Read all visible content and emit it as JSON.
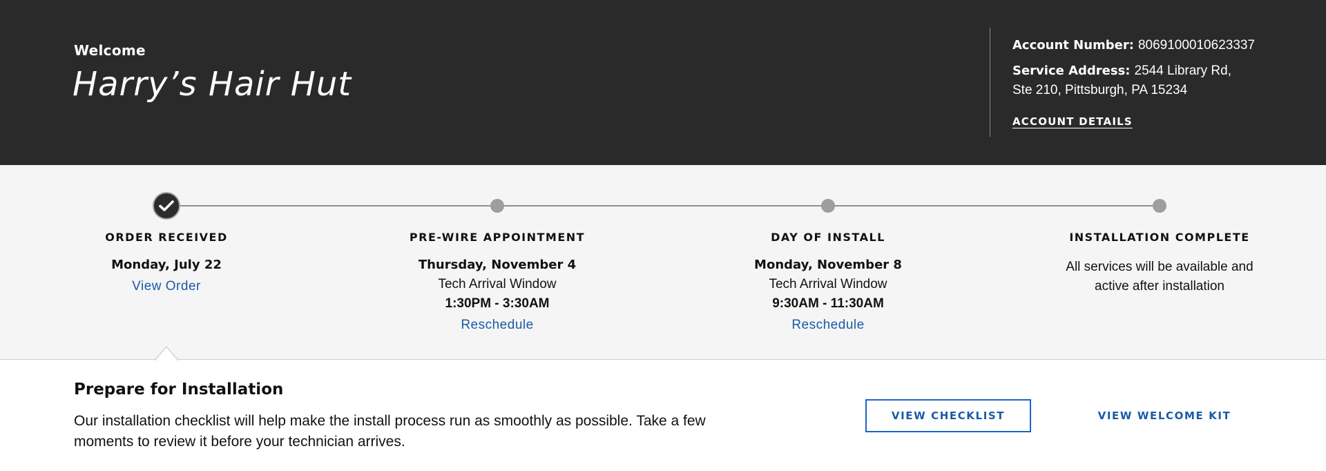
{
  "header": {
    "welcome_label": "Welcome",
    "business_name": "Harry’s Hair Hut",
    "account_number_label": "Account Number:",
    "account_number": "8069100010623337",
    "service_address_label": "Service Address:",
    "service_address_line1": "2544 Library Rd,",
    "service_address_line2": "Ste 210, Pittsburgh, PA 15234",
    "account_details_link": "ACCOUNT DETAILS"
  },
  "timeline": {
    "steps": [
      {
        "title": "ORDER RECEIVED",
        "date": "Monday, July 22",
        "link": "View Order",
        "status": "complete"
      },
      {
        "title": "PRE-WIRE APPOINTMENT",
        "date": "Thursday, November 4",
        "window_label": "Tech Arrival Window",
        "window_time": "1:30PM - 3:30AM",
        "link": "Reschedule",
        "status": "pending"
      },
      {
        "title": "DAY OF INSTALL",
        "date": "Monday, November 8",
        "window_label": "Tech Arrival Window",
        "window_time": "9:30AM - 11:30AM",
        "link": "Reschedule",
        "status": "pending"
      },
      {
        "title": "INSTALLATION COMPLETE",
        "note_line1": "All services will be available and",
        "note_line2": "active after installation",
        "status": "pending"
      }
    ]
  },
  "prepare": {
    "title": "Prepare for Installation",
    "body_line1": "Our installation checklist will help make the install process run as smoothly as possible. Take a few",
    "body_line2": "moments to review it before your technician arrives.",
    "checklist_button": "VIEW CHECKLIST",
    "welcome_kit_button": "VIEW WELCOME KIT"
  },
  "colors": {
    "header_bg": "#2a2a2a",
    "timeline_bg": "#f5f5f5",
    "link_blue": "#1a5aa6",
    "button_border": "#1a63c9",
    "node_gray": "#9e9e9e"
  },
  "icons": {
    "completed_step": "checkmark-icon"
  }
}
